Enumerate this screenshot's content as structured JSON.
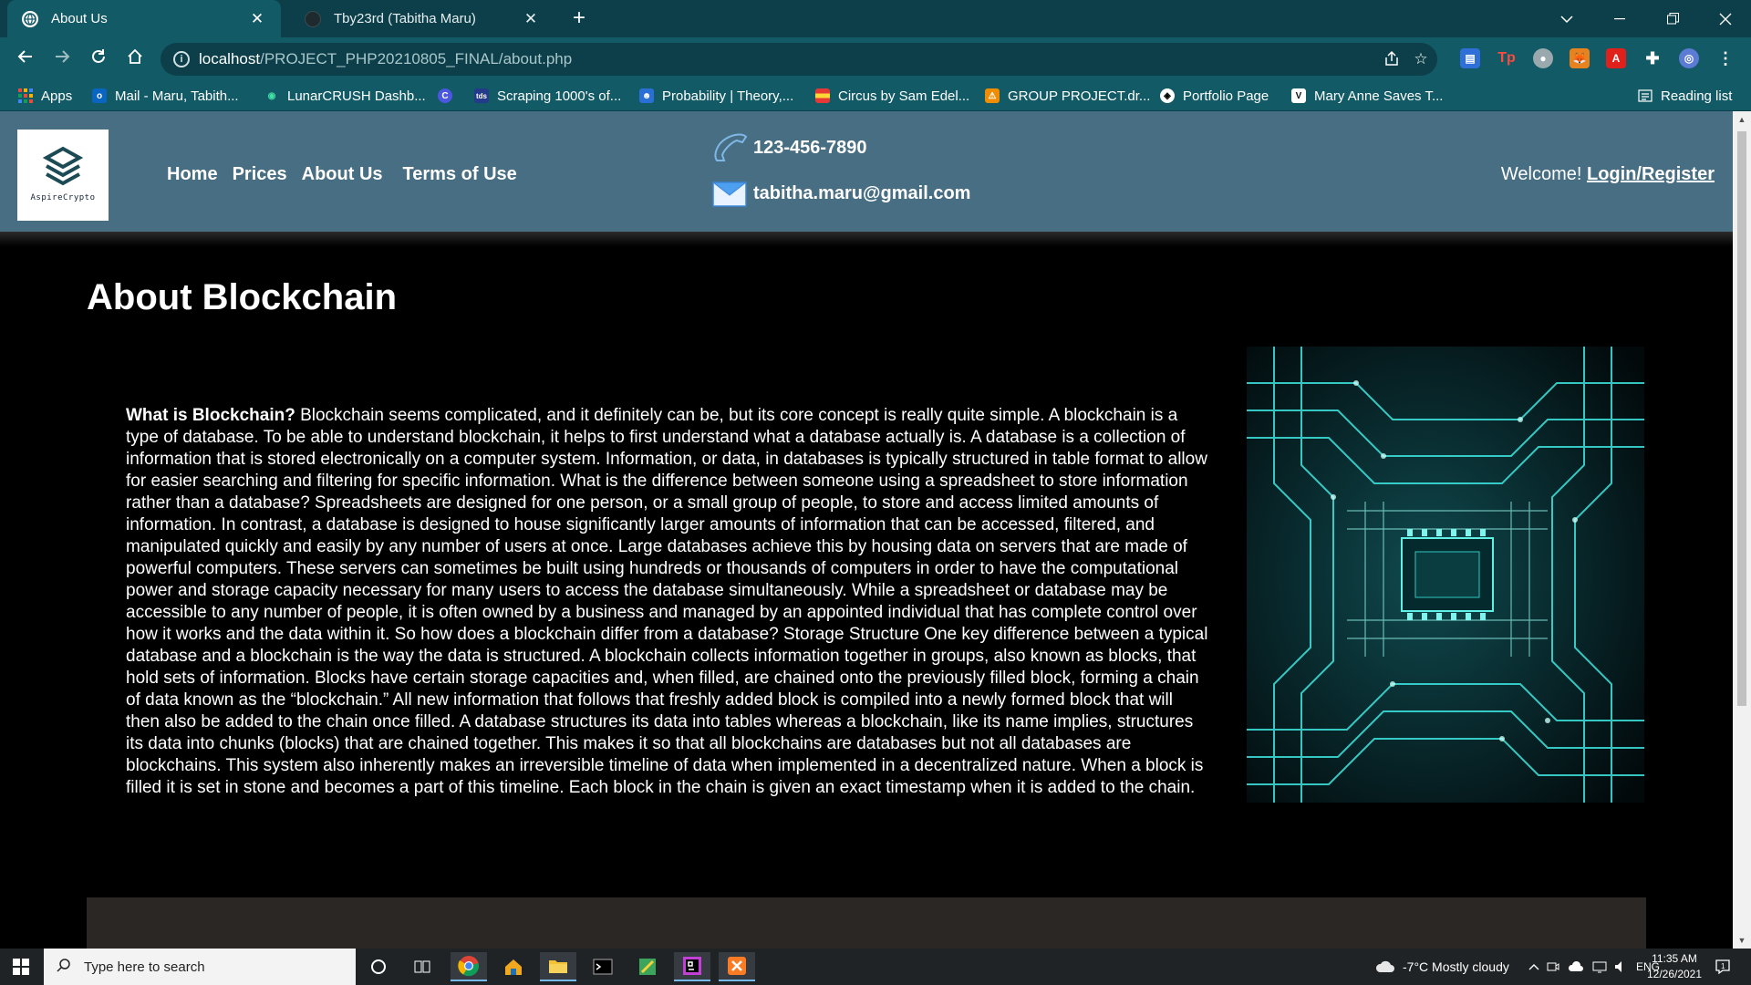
{
  "browser": {
    "tabs": [
      {
        "title": "About Us",
        "active": true
      },
      {
        "title": "Tby23rd (Tabitha Maru)",
        "active": false
      }
    ],
    "url_host": "localhost",
    "url_path": "/PROJECT_PHP20210805_FINAL/about.php",
    "bookmarks": [
      "Apps",
      "Mail - Maru, Tabith...",
      "LunarCRUSH Dashb...",
      "Scraping 1000's of...",
      "Probability | Theory,...",
      "Circus by Sam Edel...",
      "GROUP PROJECT.dr...",
      "Portfolio Page",
      "Mary Anne Saves T..."
    ],
    "reading_list": "Reading list"
  },
  "site": {
    "logo_text": "AspireCrypto",
    "nav": [
      "Home",
      "Prices",
      "About Us",
      "Terms of Use"
    ],
    "phone": "123-456-7890",
    "email": "tabitha.maru@gmail.com",
    "welcome": "Welcome!",
    "login": "Login/Register"
  },
  "content": {
    "title": "About Blockchain",
    "lead": "What is Blockchain?",
    "body": " Blockchain seems complicated, and it definitely can be, but its core concept is really quite simple. A blockchain is a type of database. To be able to understand blockchain, it helps to first understand what a database actually is. A database is a collection of information that is stored electronically on a computer system. Information, or data, in databases is typically structured in table format to allow for easier searching and filtering for specific information. What is the difference between someone using a spreadsheet to store information rather than a database? Spreadsheets are designed for one person, or a small group of people, to store and access limited amounts of information. In contrast, a database is designed to house significantly larger amounts of information that can be accessed, filtered, and manipulated quickly and easily by any number of users at once. Large databases achieve this by housing data on servers that are made of powerful computers. These servers can sometimes be built using hundreds or thousands of computers in order to have the computational power and storage capacity necessary for many users to access the database simultaneously. While a spreadsheet or database may be accessible to any number of people, it is often owned by a business and managed by an appointed individual that has complete control over how it works and the data within it. So how does a blockchain differ from a database? Storage Structure One key difference between a typical database and a blockchain is the way the data is structured. A blockchain collects information together in groups, also known as blocks, that hold sets of information. Blocks have certain storage capacities and, when filled, are chained onto the previously filled block, forming a chain of data known as the “blockchain.” All new information that follows that freshly added block is compiled into a newly formed block that will then also be added to the chain once filled. A database structures its data into tables whereas a blockchain, like its name implies, structures its data into chunks (blocks) that are chained together. This makes it so that all blockchains are databases but not all databases are blockchains. This system also inherently makes an irreversible timeline of data when implemented in a decentralized nature. When a block is filled it is set in stone and becomes a part of this timeline. Each block in the chain is given an exact timestamp when it is added to the chain."
  },
  "taskbar": {
    "search_placeholder": "Type here to search",
    "weather": "-7°C  Mostly cloudy",
    "lang": "ENG",
    "time": "11:35 AM",
    "date": "12/26/2021"
  },
  "colors": {
    "chrome_dark": "#0c3f49",
    "chrome": "#125a66",
    "site_header": "#476e82",
    "accent_circuit": "#3ee6e0"
  }
}
